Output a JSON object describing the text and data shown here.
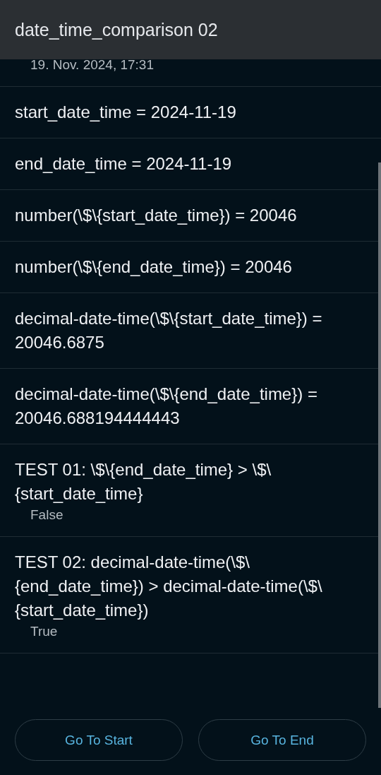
{
  "header": {
    "title": "date_time_comparison 02"
  },
  "date": "19. Nov. 2024, 17:31",
  "items": [
    {
      "text": "start_date_time = 2024-11-19"
    },
    {
      "text": "end_date_time = 2024-11-19"
    },
    {
      "text": "number(\\$\\{start_date_time}) = 20046"
    },
    {
      "text": "number(\\$\\{end_date_time}) = 20046"
    },
    {
      "text": "decimal-date-time(\\$\\{start_date_time}) = 20046.6875"
    },
    {
      "text": "decimal-date-time(\\$\\{end_date_time}) = 20046.688194444443"
    },
    {
      "text": "TEST 01: \\$\\{end_date_time} > \\$\\{start_date_time}",
      "answer": "False"
    },
    {
      "text": "TEST 02: decimal-date-time(\\$\\{end_date_time}) > decimal-date-time(\\$\\{start_date_time})",
      "answer": "True"
    }
  ],
  "buttons": [
    "Go To Start",
    "Go To End"
  ]
}
